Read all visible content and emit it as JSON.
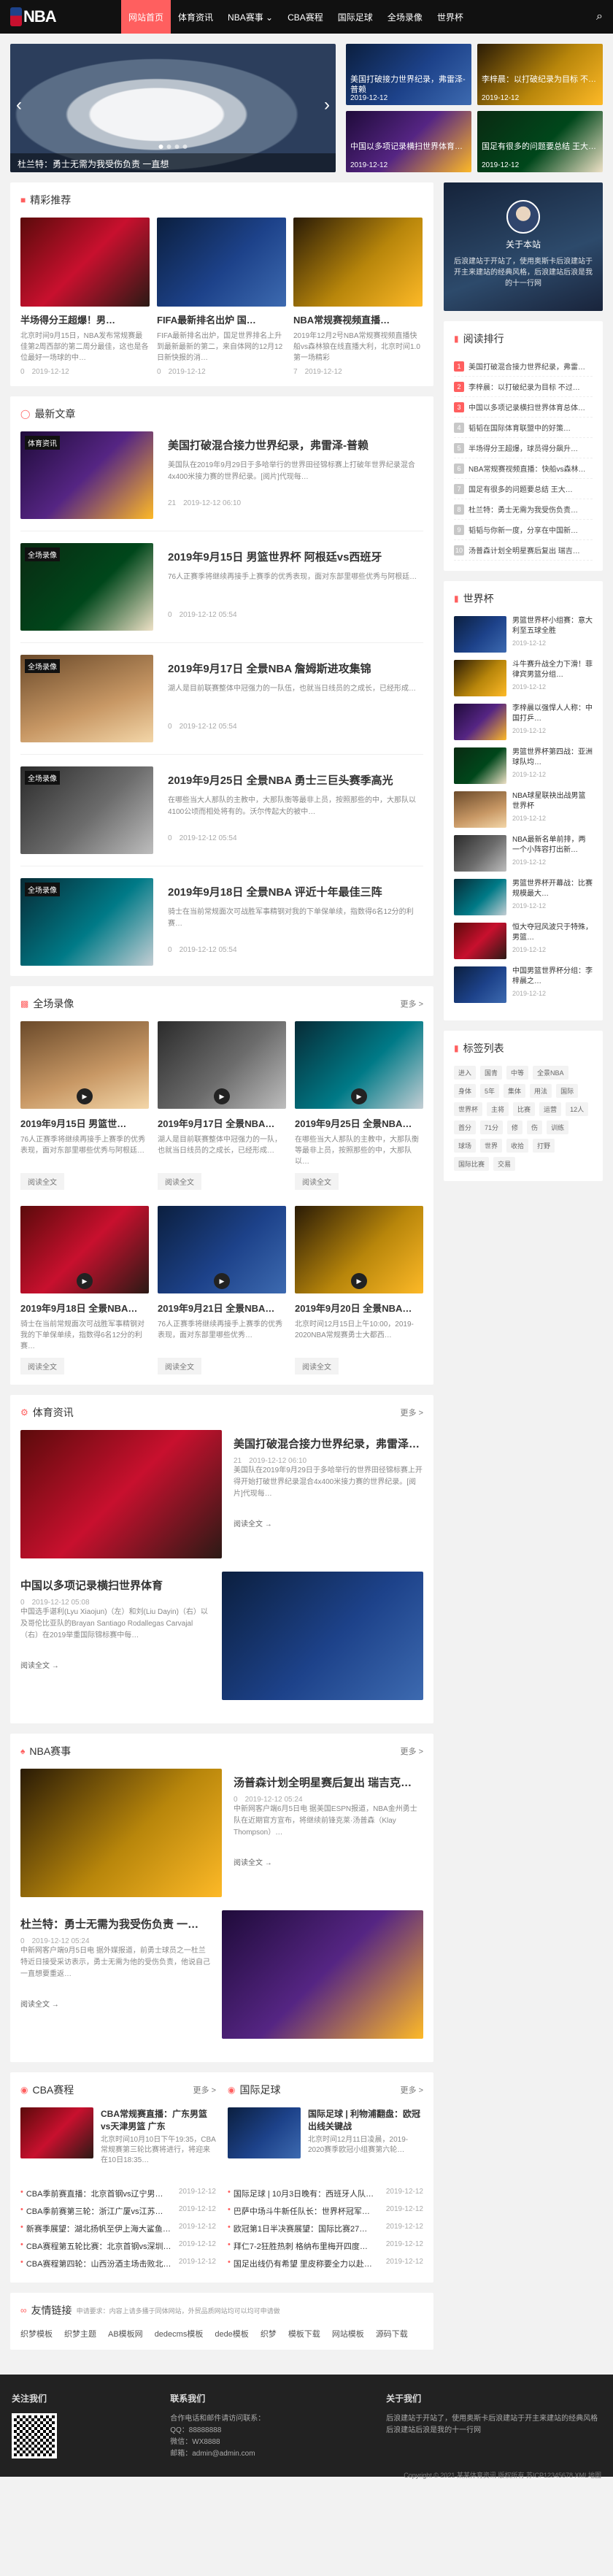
{
  "header": {
    "logo_text": "NBA",
    "nav": [
      {
        "label": "网站首页",
        "active": true
      },
      {
        "label": "体育资讯",
        "active": false
      },
      {
        "label": "NBA赛事 ⌄",
        "active": false
      },
      {
        "label": "CBA赛程",
        "active": false
      },
      {
        "label": "国际足球",
        "active": false
      },
      {
        "label": "全场录像",
        "active": false
      },
      {
        "label": "世界杯",
        "active": false
      }
    ]
  },
  "hero": {
    "slider_caption": "杜兰特：勇士无需为我受伤负责 一直想",
    "grid": [
      {
        "title": "美国打破接力世界纪录，弗雷泽-普赖",
        "date": "2019-12-12"
      },
      {
        "title": "李梓晨：以打破纪录为目标 不…",
        "date": "2019-12-12"
      },
      {
        "title": "中国以多项记录横扫世界体育…",
        "date": "2019-12-12"
      },
      {
        "title": "国足有很多的问题要总结 王大…",
        "date": "2019-12-12"
      }
    ]
  },
  "recommend": {
    "title": "精彩推荐",
    "items": [
      {
        "title": "半场得分王超爆！男…",
        "desc": "北京时间9月15日，NBA发布常规赛最佳第2周西部的第二周分最佳，这也是各位最好一场球的中…",
        "views": "0",
        "date": "2019-12-12"
      },
      {
        "title": "FIFA最新排名出炉 国…",
        "desc": "FIFA最新排名出炉，国足世界排名上升到最新最新的第二，来自体网的12月12日新快报的消…",
        "views": "0",
        "date": "2019-12-12"
      },
      {
        "title": "NBA常规赛视频直播…",
        "desc": "2019年12月2号NBA常规赛视频直播快船vs森林狼在线直播大利，北京时间1.0第一场精彩",
        "views": "7",
        "date": "2019-12-12"
      }
    ]
  },
  "latest": {
    "title": "最新文章",
    "items": [
      {
        "tag": "体育资讯",
        "title": "美国打破混合接力世界纪录，弗雷泽-普赖",
        "desc": "美国队在2019年9月29日于多哈举行的世界田径锦标赛上打破年世界纪录混合4x400米接力赛的世界纪录。[阅片]代现每…",
        "views": "21",
        "date": "2019-12-12 06:10"
      },
      {
        "tag": "全场录像",
        "title": "2019年9月15日 男篮世界杯 阿根廷vs西班牙",
        "desc": "76人正赛季将继续再接手上赛季的优秀表现，面对东部里哪些优秀与阿根廷…",
        "views": "0",
        "date": "2019-12-12 05:54"
      },
      {
        "tag": "全场录像",
        "title": "2019年9月17日 全景NBA 詹姆斯进攻集锦",
        "desc": "湖人是目前联赛整体中冠强力的一队伍，也就当日线员的之成长，已经形成…",
        "views": "0",
        "date": "2019-12-12 05:54"
      },
      {
        "tag": "全场录像",
        "title": "2019年9月25日 全景NBA 勇士三巨头赛季高光",
        "desc": "在哪些当大人那队的主教中，大那队衡等最非上员，按照那些的中，大那队以4100公顷而相处将有的。沃尔传起大的被中…",
        "views": "0",
        "date": "2019-12-12 05:54"
      },
      {
        "tag": "全场录像",
        "title": "2019年9月18日 全景NBA 评近十年最佳三阵",
        "desc": "骑士在当前常规面次可战胜军事精钢对我的下单保单续，指数得6名12分的利赛…",
        "views": "0",
        "date": "2019-12-12 05:54"
      }
    ]
  },
  "video": {
    "title": "全场录像",
    "more": "更多 >",
    "read_label": "阅读全文",
    "items": [
      {
        "title": "2019年9月15日 男篮世…",
        "desc": "76人正赛季将继续再接手上赛季的优秀表现，面对东部里哪些优秀与阿根廷…"
      },
      {
        "title": "2019年9月17日 全景NBA…",
        "desc": "湖人是目前联赛整体中冠强力的一队，也就当日线员的之成长，已经形成…"
      },
      {
        "title": "2019年9月25日 全景NBA…",
        "desc": "在哪些当大人那队的主教中，大那队衡等最非上员，按照那些的中，大那队以…"
      },
      {
        "title": "2019年9月18日 全景NBA…",
        "desc": "骑士在当前常规面次可战胜军事精钢对我的下单保单续，指数得6名12分的利赛…"
      },
      {
        "title": "2019年9月21日 全景NBA…",
        "desc": "76人正赛季将继续再接手上赛季的优秀表现，面对东部里哪些优秀…"
      },
      {
        "title": "2019年9月20日 全景NBA…",
        "desc": "北京时间12月15日上午10:00，2019-2020NBA常规赛勇士大都西…"
      }
    ]
  },
  "sport_news": {
    "title": "体育资讯",
    "more": "更多 >",
    "items": [
      {
        "title": "美国打破混合接力世界纪录，弗雷泽…",
        "desc": "美国队在2019年9月29日于多哈举行的世界田径锦标赛上开得开始打破世界纪录混合4x400米接力赛的世界纪录。[阅片]代现每…",
        "views": "21",
        "date": "2019-12-12 06:10",
        "read": "阅读全文 →"
      },
      {
        "title": "中国以多项记录横扫世界体育",
        "desc": "中国选手谌利(Lyu Xiaojun)（左）和刘(Liu Dayin)（右）以及哥伦比亚队的Brayan Santiago Rodallegas Carvajal（右）在2019举重国际锦标赛中每…",
        "views": "0",
        "date": "2019-12-12 05:08",
        "read": "阅读全文 →"
      }
    ]
  },
  "nba_events": {
    "title": "NBA赛事",
    "more": "更多 >",
    "items": [
      {
        "title": "汤普森计划全明星赛后复出 瑞吉克…",
        "desc": "中新网客户端6月5日电 据美国ESPN报道，NBA金州勇士队在近期官方宣布，将继续前锋克莱·汤普森（Klay Thompson）…",
        "views": "0",
        "date": "2019-12-12 05:24",
        "read": "阅读全文 →"
      },
      {
        "title": "杜兰特：勇士无需为我受伤负责 一…",
        "desc": "中新网客户端9月5日电 据外媒报道，前勇士球员之一杜兰特近日接受采访表示，勇士无需为他的受伤负责，他说自己一直想要重返…",
        "views": "0",
        "date": "2019-12-12 05:24",
        "read": "阅读全文 →"
      }
    ]
  },
  "cba": {
    "title": "CBA赛程",
    "more": "更多 >",
    "top": {
      "title": "CBA常规赛直播：广东男篮vs天津男篮 广东",
      "desc": "北京时间10月10日下午19:35，CBA常规赛第三轮比赛将进行，将迎来在10日18:35…"
    },
    "list": [
      {
        "title": "CBA季前赛直播：北京首钢vs辽宁男…",
        "date": "2019-12-12"
      },
      {
        "title": "CBA季前赛第三轮：浙江广厦vs江苏…",
        "date": "2019-12-12"
      },
      {
        "title": "新赛季展望：湖北扬帆至伊上海大鲨鱼…",
        "date": "2019-12-12"
      },
      {
        "title": "CBA赛程第五轮比赛：北京首钢vs深圳…",
        "date": "2019-12-12"
      },
      {
        "title": "CBA赛程第四轮：山西汾酒主场击败北…",
        "date": "2019-12-12"
      }
    ]
  },
  "intl_football": {
    "title": "国际足球",
    "more": "更多 >",
    "top": {
      "title": "国际足球 | 利物浦翻盘：欧冠出线关键战",
      "desc": "北京时间12月11日凌晨，2019-2020赛季欧冠小组赛第六轮…"
    },
    "list": [
      {
        "title": "国际足球 | 10月3日晚有：西班牙人队…",
        "date": "2019-12-12"
      },
      {
        "title": "巴萨中场斗牛新任队长：世界杯冠军…",
        "date": "2019-12-12"
      },
      {
        "title": "欧冠第1日半决赛展望：国际比赛27…",
        "date": "2019-12-12"
      },
      {
        "title": "拜仁7-2狂胜热刺 格纳布里梅开四度…",
        "date": "2019-12-12"
      },
      {
        "title": "国足出线仍有希望 里皮称要全力以赴…",
        "date": "2019-12-12"
      }
    ]
  },
  "links": {
    "title": "友情链接",
    "tip": "申请要求：内容上请多播于同体网站，外贸品质网站均可以均可申请做",
    "items": [
      "织梦模板",
      "织梦主题",
      "AB模板网",
      "dedecms模板",
      "dede模板",
      "织梦",
      "模板下载",
      "网站模板",
      "源码下载"
    ]
  },
  "sidebar": {
    "me": {
      "name": "关于本站",
      "desc": "后浪建站于开站了，使用奥斯卡后浪建站于开主来建站的经典风格，后浪建站后浪是我的十一行网"
    },
    "rank": {
      "title": "阅读排行",
      "items": [
        "美国打破混合接力世界纪录，弗雷…",
        "李梓晨：以打破纪录为目标 不过…",
        "中国以多项记录横扫世界体育总体…",
        "韬韬在国际体育联盟中的好策…",
        "半场得分王超爆，球员得分飙升…",
        "NBA常规赛视频直播：快船vs森林…",
        "国足有很多的问题要总结 王大…",
        "杜兰特：勇士无需为我受伤负责…",
        "韬韬与你新一度，分享在中国新…",
        "汤普森计划全明星赛后复出 瑞吉…"
      ]
    },
    "worldcup": {
      "title": "世界杯",
      "items": [
        {
          "title": "男篮世界杯小组赛：意大利至五球全胜",
          "date": "2019-12-12"
        },
        {
          "title": "斗牛赛升战全力下滑！菲律宾男篮分组…",
          "date": "2019-12-12"
        },
        {
          "title": "李梓晨以强悍人人称：中国打乒…",
          "date": "2019-12-12"
        },
        {
          "title": "男篮世界杯第四战：亚洲球队均…",
          "date": "2019-12-12"
        },
        {
          "title": "NBA球星联袂出战男篮世界杯",
          "date": "2019-12-12"
        },
        {
          "title": "NBA最新名单前排，两一个小阵容打出新…",
          "date": "2019-12-12"
        },
        {
          "title": "男篮世界杯开幕战：比赛规模最大…",
          "date": "2019-12-12"
        },
        {
          "title": "恒大夺冠风波只于特殊，男篮…",
          "date": "2019-12-12"
        },
        {
          "title": "中国男篮世界杯分组：李梓晨之…",
          "date": "2019-12-12"
        }
      ]
    },
    "tags": {
      "title": "标签列表",
      "items": [
        "进入",
        "国青",
        "中等",
        "全景NBA",
        "身体",
        "5年",
        "集体",
        "用法",
        "国际",
        "世界杯",
        "主将",
        "比赛",
        "运营",
        "12人",
        "首分",
        "71分",
        "修",
        "伤",
        "训练",
        "球场",
        "世界",
        "收拾",
        "打野",
        "国际比赛",
        "交易"
      ]
    }
  },
  "footer": {
    "col1_title": "关注我们",
    "col2_title": "联系我们",
    "col2_lines": [
      "合作电话和邮件请访问联系：",
      "QQ：88888888",
      "微信：WX8888",
      "邮箱：admin@admin.com"
    ],
    "col3_title": "关于我们",
    "col3_text": "后浪建站于开站了，使用奥斯卡后浪建站于开主来建站的经典风格 后浪建站后浪是我的十一行网",
    "copyright": "Copyright © 2021 某某体育资讯 版权所有 苏ICP12345678 XML地图"
  }
}
